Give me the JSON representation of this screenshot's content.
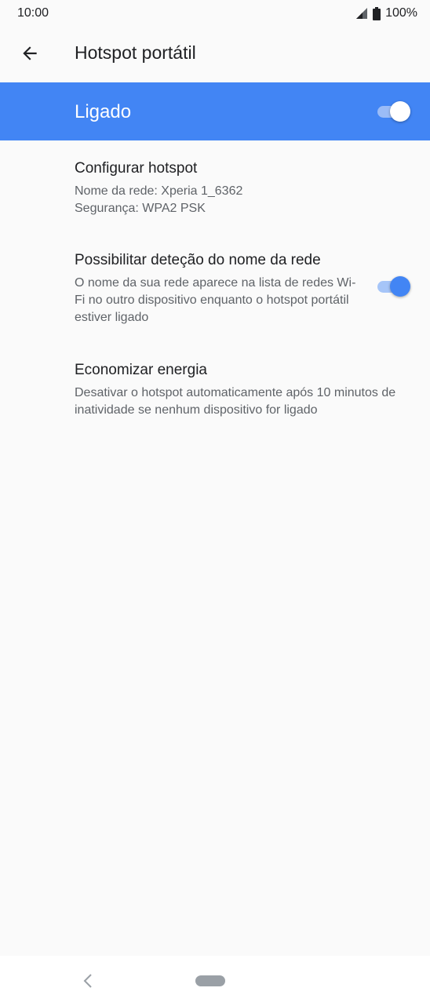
{
  "status_bar": {
    "time": "10:00",
    "battery": "100%",
    "icons": [
      "signal-icon",
      "battery-icon"
    ]
  },
  "app_bar": {
    "title": "Hotspot portátil",
    "back_icon": "arrow-back-icon"
  },
  "master_switch": {
    "label": "Ligado",
    "on": true
  },
  "settings": [
    {
      "title": "Configurar hotspot",
      "summary_lines": [
        "Nome da rede: Xperia 1_6362",
        "Segurança: WPA2 PSK"
      ]
    },
    {
      "title": "Possibilitar deteção do nome da rede",
      "summary": "O nome da sua rede aparece na lista de redes Wi-Fi no outro dispositivo enquanto o hotspot portátil estiver ligado",
      "switch_on": true
    },
    {
      "title": "Economizar energia",
      "summary": "Desativar o hotspot automaticamente após 10 minutos de inatividade se nenhum dispositivo for ligado"
    }
  ],
  "nav_bar": {
    "icons": [
      "nav-back-icon",
      "home-pill-icon"
    ]
  },
  "colors": {
    "accent": "#4285f4",
    "background": "#fafafa",
    "text_primary": "#202124",
    "text_secondary": "#5f6368"
  }
}
